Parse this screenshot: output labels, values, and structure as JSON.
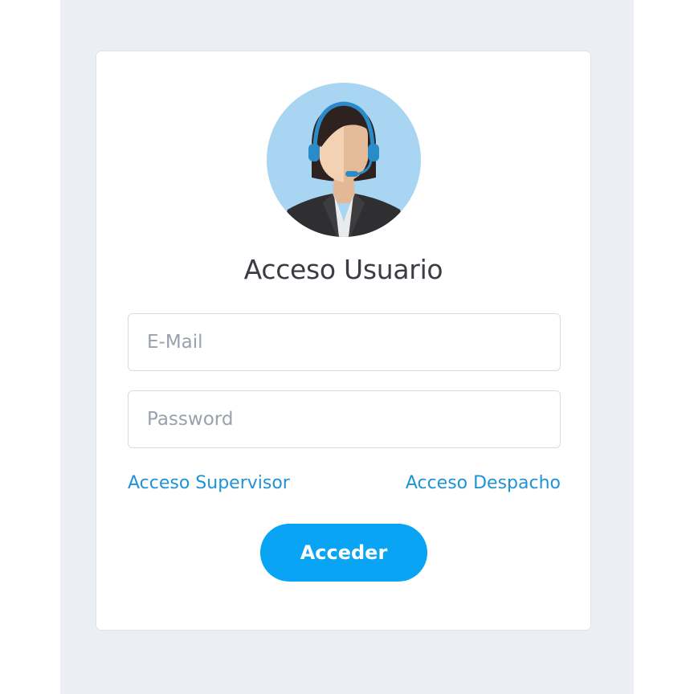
{
  "login": {
    "title": "Acceso Usuario",
    "email": {
      "placeholder": "E-Mail",
      "value": ""
    },
    "password": {
      "placeholder": "Password",
      "value": ""
    },
    "links": {
      "supervisor": "Acceso Supervisor",
      "dispatch": "Acceso Despacho"
    },
    "submit_label": "Acceder"
  },
  "avatar": {
    "icon": "operator-headset-avatar-icon"
  },
  "colors": {
    "page_background": "#ebeef3",
    "card_background": "#ffffff",
    "accent": "#09a4f3",
    "link": "#1f93d6",
    "title_text": "#3a3d44",
    "placeholder_text": "#9aa1ac",
    "avatar_circle": "#a8d5f2"
  }
}
